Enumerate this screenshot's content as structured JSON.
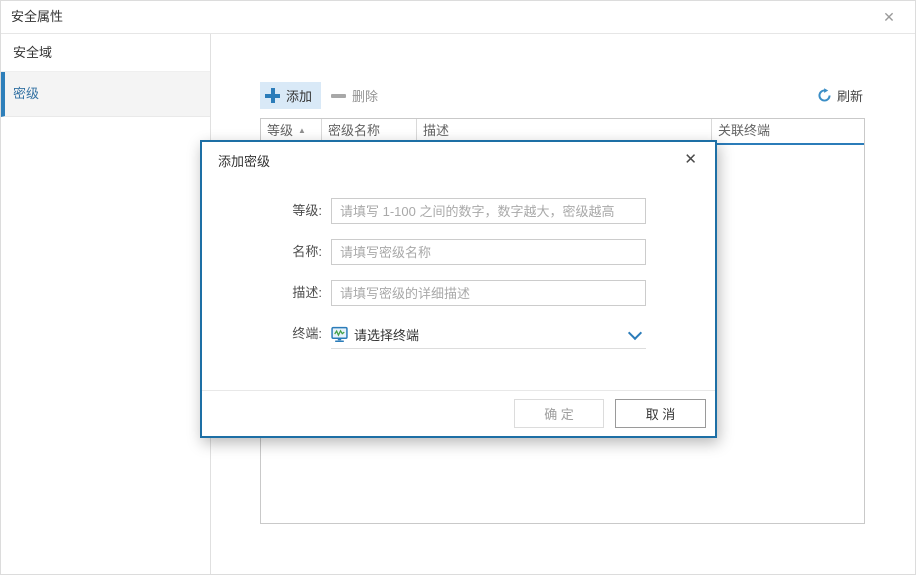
{
  "window": {
    "title": "安全属性"
  },
  "sidebar": {
    "items": [
      {
        "label": "安全域",
        "selected": false
      },
      {
        "label": "密级",
        "selected": true
      }
    ]
  },
  "toolbar": {
    "add_label": "添加",
    "delete_label": "删除",
    "refresh_label": "刷新"
  },
  "table": {
    "columns": [
      "等级",
      "密级名称",
      "描述",
      "关联终端"
    ],
    "rows": []
  },
  "modal": {
    "title": "添加密级",
    "fields": [
      {
        "label": "等级:",
        "placeholder": "请填写 1-100 之间的数字，数字越大，密级越高"
      },
      {
        "label": "名称:",
        "placeholder": "请填写密级名称"
      },
      {
        "label": "描述:",
        "placeholder": "请填写密级的详细描述"
      },
      {
        "label": "终端:",
        "value": "请选择终端"
      }
    ],
    "confirm_label": "确 定",
    "cancel_label": "取 消"
  },
  "icons": {
    "window_close": "✕",
    "modal_close": "✕",
    "sort_asc": "▲"
  },
  "colors": {
    "accent_blue": "#2b7cb9",
    "modal_border": "#1d6fa5",
    "selected_sidebar_text": "#3472a3",
    "add_button_bg": "#d9e9f7",
    "table_header_underline": "#2b7cb9",
    "waveform_green": "#43a047"
  }
}
